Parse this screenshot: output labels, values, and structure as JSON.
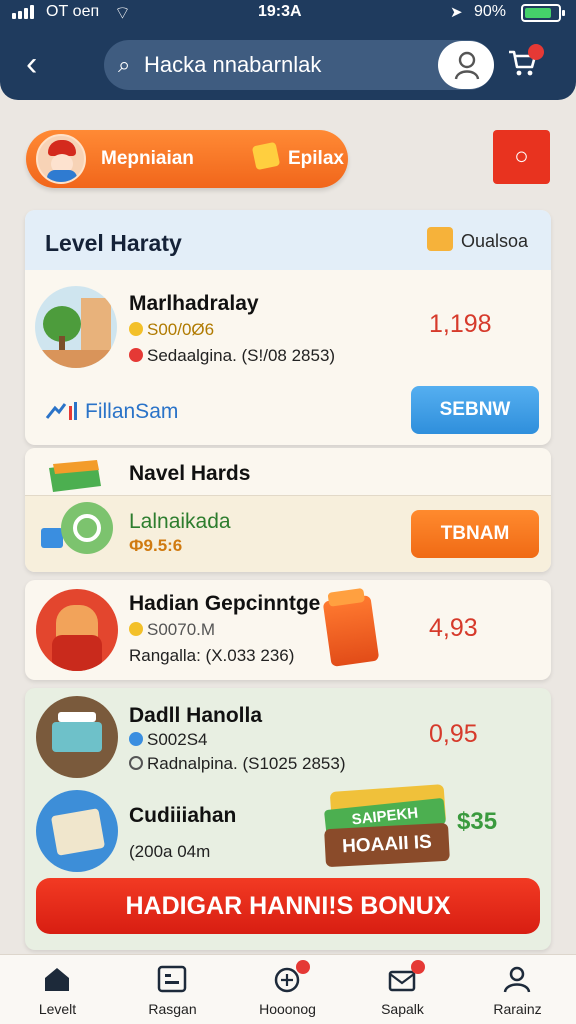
{
  "status_bar": {
    "carrier": "ОТ оеп",
    "time": "19:3A",
    "battery": "90%"
  },
  "search": {
    "value": "Hacka nnabarnlak"
  },
  "promo": {
    "label": "Mepniaian",
    "label2": "Epilax",
    "accent": "#f1661b"
  },
  "card1": {
    "title": "Level Haraty",
    "badge": "Oualsoa",
    "item": {
      "name": "Marlhadralay",
      "price_line": "S00/0Ø6",
      "sub_line": "Sedaalgina. (S!/08 2853)",
      "price": "1,198"
    },
    "footer_text": "FillanSam",
    "button": "SEBNW"
  },
  "card2": {
    "title": "Navel Hards",
    "item_name": "Lalnaikada",
    "item_price": "Ф9.5:6",
    "button": "TBNAM"
  },
  "card3": {
    "name": "Hadian Gepcinntge",
    "price_line": "S0070.M",
    "sub_line": "Rangalla: (X.033 236)",
    "price": "4,93"
  },
  "card4": {
    "item1": {
      "name": "Dadll Hanolla",
      "price_line": "S002S4",
      "sub_line": "Radnalpina. (S1025 2853)",
      "price": "0,95"
    },
    "item2": {
      "name": "Cudiiiahan",
      "sub_line": "(200a 04m"
    },
    "sticker_top": "SAIPEKH",
    "sticker_main": "HOAAII IS",
    "sticker_amount": "$35",
    "bonus_button": "HADIGAR HANNI!S BONUX"
  },
  "nav": {
    "items": [
      {
        "label": "Levelt",
        "icon": "home-icon"
      },
      {
        "label": "Rasgan",
        "icon": "board-icon"
      },
      {
        "label": "Hooonog",
        "icon": "gift-icon"
      },
      {
        "label": "Sapalk",
        "icon": "mail-icon"
      },
      {
        "label": "Rarainz",
        "icon": "profile-icon"
      }
    ]
  },
  "colors": {
    "header": "#1f3b5e",
    "price": "#d63a2b",
    "blue_button": "#2f8fdc",
    "orange_button": "#f06a15",
    "bonus_button": "#d81e12"
  }
}
